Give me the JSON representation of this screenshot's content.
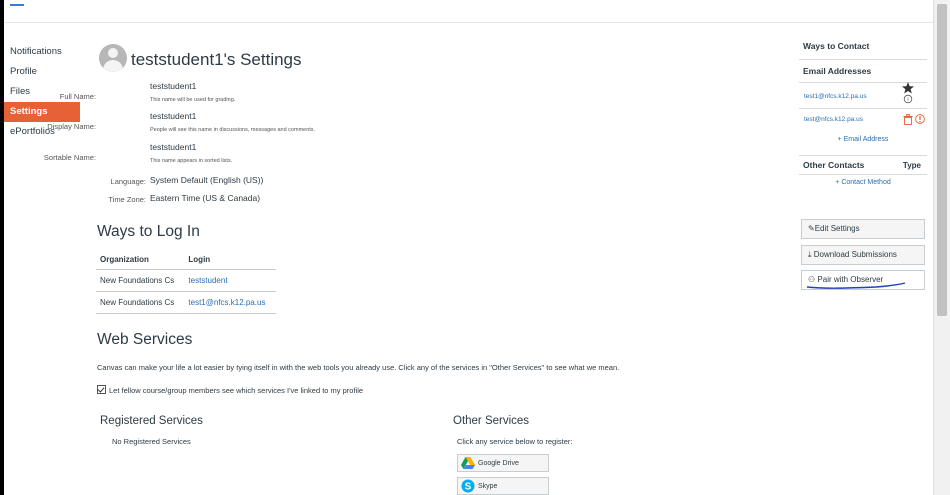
{
  "nav": {
    "items": [
      {
        "label": "Notifications"
      },
      {
        "label": "Profile"
      },
      {
        "label": "Files"
      },
      {
        "label": "Settings"
      },
      {
        "label": "ePortfolios"
      }
    ],
    "active_index": 3
  },
  "settings": {
    "title": "teststudent1's Settings",
    "full_name": {
      "label": "Full Name:",
      "value": "teststudent1",
      "hint": "This name will be used for grading."
    },
    "display_name": {
      "label": "Display Name:",
      "value": "teststudent1",
      "hint": "People will see this name in discussions, messages and comments."
    },
    "sortable_name": {
      "label": "Sortable Name:",
      "value": "teststudent1",
      "hint": "This name appears in sorted lists."
    },
    "language": {
      "label": "Language:",
      "value": "System Default (English (US))"
    },
    "time_zone": {
      "label": "Time Zone:",
      "value": "Eastern Time (US & Canada)"
    }
  },
  "ways_to_log_in": {
    "heading": "Ways to Log In",
    "columns": [
      "Organization",
      "Login"
    ],
    "rows": [
      {
        "organization": "New Foundations Cs",
        "login": "teststudent"
      },
      {
        "organization": "New Foundations Cs",
        "login": "test1@nfcs.k12.pa.us"
      }
    ]
  },
  "web_services": {
    "heading": "Web Services",
    "description": "Canvas can make your life a lot easier by tying itself in with the web tools you already use. Click any of the services in \"Other Services\" to see what we mean.",
    "share_checkbox_label": "Let fellow course/group members see which services I've linked to my profile",
    "share_checked": true,
    "registered_heading": "Registered Services",
    "registered_empty": "No Registered Services",
    "other_heading": "Other Services",
    "other_sub": "Click any service below to register:",
    "services": [
      {
        "label": "Google Drive",
        "icon": "google-drive-icon"
      },
      {
        "label": "Skype",
        "icon": "skype-icon"
      }
    ]
  },
  "contact": {
    "title": "Ways to Contact",
    "email_heading": "Email Addresses",
    "emails": [
      "test1@nfcs.k12.pa.us",
      "test@nfcs.k12.pa.us"
    ],
    "add_email": "Email Address",
    "other_heading": "Other Contacts",
    "type_heading": "Type",
    "add_contact": "Contact Method"
  },
  "actions": {
    "edit_settings": "Edit Settings",
    "download_submissions": "Download Submissions",
    "pair_with_observer": "Pair with Observer"
  },
  "colors": {
    "accent": "#e66135",
    "link": "#2a6fb2",
    "annotation": "#1f3fbf"
  }
}
